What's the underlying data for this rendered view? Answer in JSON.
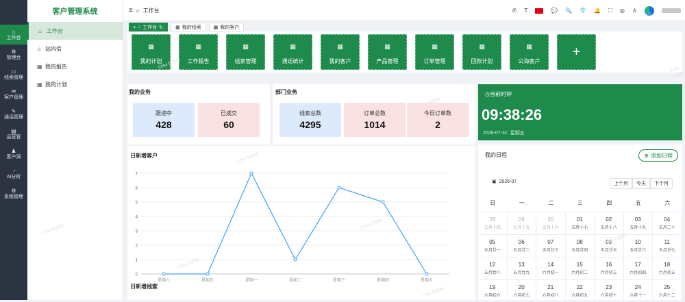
{
  "rail": [
    {
      "icon": "⌂",
      "label": "工作台"
    },
    {
      "icon": "⚙",
      "label": "管理台"
    },
    {
      "icon": "▭",
      "label": "线索管理"
    },
    {
      "icon": "✉",
      "label": "客户管理"
    },
    {
      "icon": "✎",
      "label": "通话管理"
    },
    {
      "icon": "▤",
      "label": "运营管"
    },
    {
      "icon": "♟",
      "label": "客户洞"
    },
    {
      "icon": "◔",
      "label": "AI分析"
    },
    {
      "icon": "⚙",
      "label": "系统管理"
    }
  ],
  "menu": {
    "title": "客户管理系统",
    "items": [
      {
        "icon": "⌂",
        "label": "工作台"
      },
      {
        "icon": "♫",
        "label": "站内信"
      },
      {
        "icon": "▦",
        "label": "我的报告"
      },
      {
        "icon": "▦",
        "label": "我的计划"
      }
    ]
  },
  "topbar": {
    "home_icon": "⌂",
    "breadcrumb": "工作台",
    "icons": [
      "✆",
      "T",
      "flag",
      "💬",
      "🔍",
      "👕",
      "🔔",
      "⛶",
      "◎",
      "♙"
    ]
  },
  "tabs": [
    {
      "label": "工作台",
      "active": true
    },
    {
      "label": "我的线索",
      "active": false
    },
    {
      "label": "我的客户",
      "active": false
    }
  ],
  "quick": [
    "我的计划",
    "工作报告",
    "线索管理",
    "通话统计",
    "我的客户",
    "产品管理",
    "订单管理",
    "回款计划",
    "公海客户"
  ],
  "my_business": {
    "title": "我的业务",
    "stats": [
      {
        "label": "跟进中",
        "value": "428"
      },
      {
        "label": "已成交",
        "value": "60"
      }
    ]
  },
  "dept_business": {
    "title": "部门业务",
    "stats": [
      {
        "label": "线索总数",
        "value": "4295"
      },
      {
        "label": "订单总数",
        "value": "1014"
      },
      {
        "label": "今日订单数",
        "value": "2"
      }
    ]
  },
  "chart_title": "日新增客户",
  "chart_data": {
    "type": "line",
    "categories": [
      "星期六",
      "星期日",
      "星期一",
      "星期二",
      "星期三",
      "星期四",
      "星期五"
    ],
    "values": [
      0,
      0,
      7,
      1,
      6,
      5,
      0
    ],
    "ylim": [
      0,
      7
    ],
    "yticks": [
      0,
      1,
      2,
      3,
      4,
      5,
      6,
      7
    ],
    "color": "#409eff",
    "grid": true
  },
  "next_section_title": "日新增线索",
  "clock": {
    "title": "当前时钟",
    "time": "09:38:26",
    "date": "2026-07-31",
    "weekday": "星期五"
  },
  "schedule": {
    "title": "我的日程",
    "add_label": "添加日程",
    "month": "2026-07",
    "prev": "上个月",
    "today": "今天",
    "next": "下个月",
    "weekdays": [
      "日",
      "一",
      "二",
      "三",
      "四",
      "五",
      "六"
    ],
    "days": [
      {
        "d": "28",
        "l": "五月十四",
        "o": true
      },
      {
        "d": "29",
        "l": "五月十五",
        "o": true
      },
      {
        "d": "30",
        "l": "五月十六",
        "o": true
      },
      {
        "d": "01",
        "l": "五月十七"
      },
      {
        "d": "02",
        "l": "五月十八"
      },
      {
        "d": "03",
        "l": "五月十九"
      },
      {
        "d": "04",
        "l": "五月二十"
      },
      {
        "d": "05",
        "l": "五月廿一"
      },
      {
        "d": "06",
        "l": "五月廿二"
      },
      {
        "d": "07",
        "l": "五月廿三"
      },
      {
        "d": "08",
        "l": "五月廿四"
      },
      {
        "d": "09",
        "l": "五月廿五"
      },
      {
        "d": "10",
        "l": "五月廿六"
      },
      {
        "d": "11",
        "l": "五月廿七"
      },
      {
        "d": "12",
        "l": "五月廿八"
      },
      {
        "d": "13",
        "l": "五月廿九"
      },
      {
        "d": "14",
        "l": "六月初一"
      },
      {
        "d": "15",
        "l": "六月初二"
      },
      {
        "d": "16",
        "l": "六月初三"
      },
      {
        "d": "17",
        "l": "六月初四"
      },
      {
        "d": "18",
        "l": "六月初五"
      },
      {
        "d": "19",
        "l": "六月初六"
      },
      {
        "d": "20",
        "l": "六月初七"
      },
      {
        "d": "21",
        "l": "六月初八"
      },
      {
        "d": "22",
        "l": "六月初九"
      },
      {
        "d": "23",
        "l": "六月初十"
      },
      {
        "d": "24",
        "l": "六月十一"
      },
      {
        "d": "25",
        "l": "六月十二"
      }
    ]
  },
  "watermark": "CRM 在使用"
}
